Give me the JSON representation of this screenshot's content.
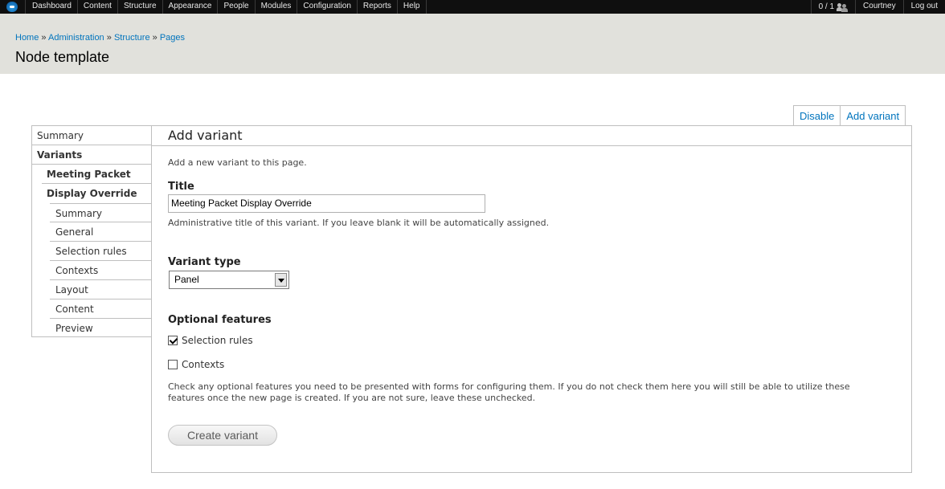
{
  "toolbar": {
    "menu": [
      "Dashboard",
      "Content",
      "Structure",
      "Appearance",
      "People",
      "Modules",
      "Configuration",
      "Reports",
      "Help"
    ],
    "user_count": "0 / 1",
    "username": "Courtney",
    "logout": "Log out"
  },
  "breadcrumb": {
    "items": [
      "Home",
      "Administration",
      "Structure",
      "Pages"
    ],
    "separator": "»"
  },
  "page_title": "Node template",
  "tabs": [
    "Disable",
    "Add variant"
  ],
  "nav": [
    {
      "label": "Summary",
      "bold": false,
      "level": 0
    },
    {
      "label": "Variants",
      "bold": true,
      "level": 0
    },
    {
      "label": "Meeting Packet",
      "bold": true,
      "level": 1
    },
    {
      "label": "Display Override",
      "bold": true,
      "level": 1
    },
    {
      "label": "Summary",
      "bold": false,
      "level": 2
    },
    {
      "label": "General",
      "bold": false,
      "level": 2
    },
    {
      "label": "Selection rules",
      "bold": false,
      "level": 2
    },
    {
      "label": "Contexts",
      "bold": false,
      "level": 2
    },
    {
      "label": "Layout",
      "bold": false,
      "level": 2
    },
    {
      "label": "Content",
      "bold": false,
      "level": 2
    },
    {
      "label": "Preview",
      "bold": false,
      "level": 2
    }
  ],
  "form": {
    "heading": "Add variant",
    "intro": "Add a new variant to this page.",
    "title_label": "Title",
    "title_value": "Meeting Packet Display Override",
    "title_help": "Administrative title of this variant. If you leave blank it will be automatically assigned.",
    "type_label": "Variant type",
    "type_value": "Panel",
    "features_label": "Optional features",
    "features": [
      {
        "label": "Selection rules",
        "checked": true
      },
      {
        "label": "Contexts",
        "checked": false
      }
    ],
    "features_help_line1": "Check any optional features you need to be presented with forms for configuring them. If you do not check them here you will still be able to utilize these",
    "features_help_line2": "features once the new page is created. If you are not sure, leave these unchecked.",
    "submit": "Create variant"
  },
  "colors": {
    "link": "#0074bd",
    "toolbar_bg": "#0f0f0f",
    "header_bg": "#e1e1dc",
    "border": "#bfbfbf"
  }
}
